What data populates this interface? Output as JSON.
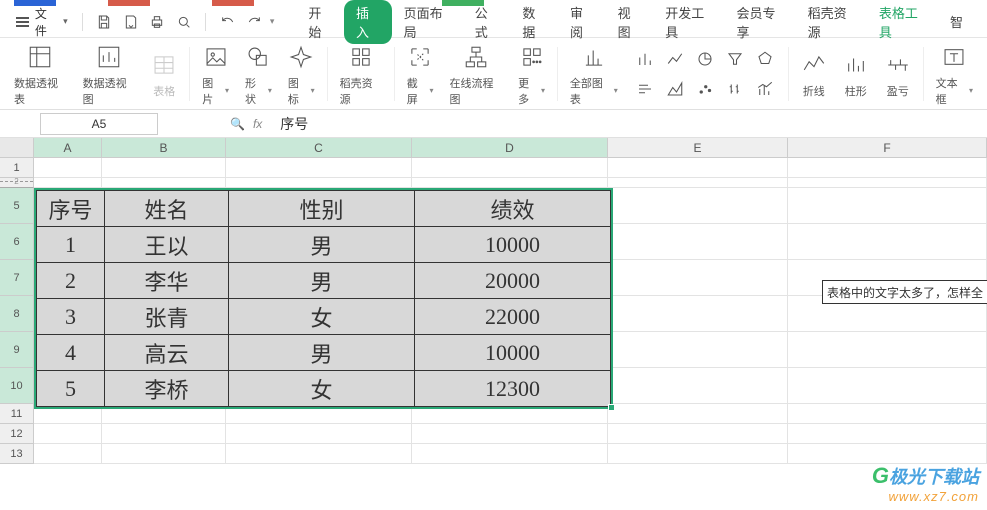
{
  "file_menu": {
    "label": "文件"
  },
  "tabs": {
    "start": "开始",
    "insert": "插入",
    "layout": "页面布局",
    "formula": "公式",
    "data": "数据",
    "review": "审阅",
    "view": "视图",
    "dev": "开发工具",
    "member": "会员专享",
    "daoke": "稻壳资源",
    "tabletool": "表格工具",
    "smart": "智"
  },
  "ribbon": {
    "pivot_table": "数据透视表",
    "pivot_chart": "数据透视图",
    "table": "表格",
    "picture": "图片",
    "shape": "形状",
    "icon": "图标",
    "daoke_res": "稻壳资源",
    "screenshot": "截屏",
    "online_flow": "在线流程图",
    "more": "更多",
    "all_charts": "全部图表",
    "sparkline_line": "折线",
    "sparkline_bar": "柱形",
    "sparkline_winloss": "盈亏",
    "textbox": "文本框"
  },
  "namebox": "A5",
  "formula": "序号",
  "colheads": [
    "A",
    "B",
    "C",
    "D",
    "E",
    "F"
  ],
  "rowheads": [
    "1",
    "2",
    "5",
    "6",
    "7",
    "8",
    "9",
    "10",
    "11",
    "12",
    "13"
  ],
  "note": "表格中的文字太多了，怎样全",
  "chart_data": {
    "type": "table",
    "headers": [
      "序号",
      "姓名",
      "性别",
      "绩效"
    ],
    "rows": [
      [
        "1",
        "王以",
        "男",
        "10000"
      ],
      [
        "2",
        "李华",
        "男",
        "20000"
      ],
      [
        "3",
        "张青",
        "女",
        "22000"
      ],
      [
        "4",
        "高云",
        "男",
        "10000"
      ],
      [
        "5",
        "李桥",
        "女",
        "12300"
      ]
    ]
  },
  "watermark": {
    "brand_cn": "极光下载站",
    "url": "www.xz7.com"
  }
}
